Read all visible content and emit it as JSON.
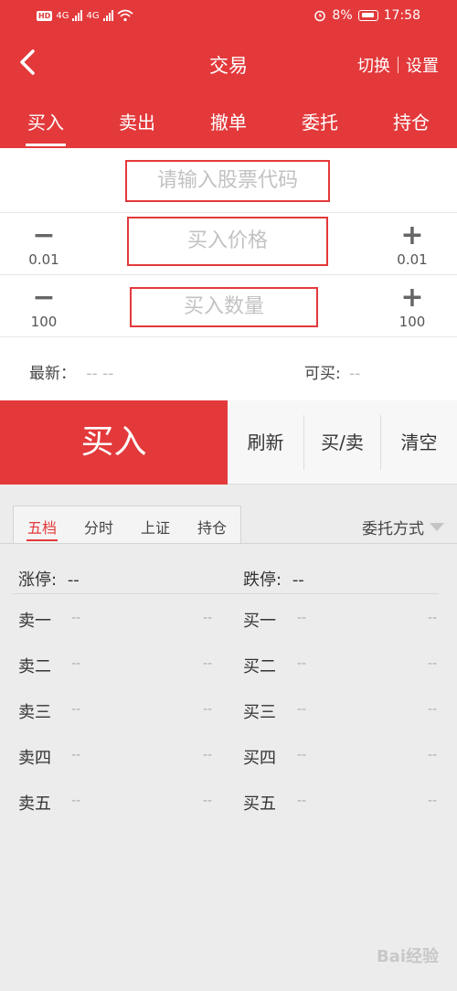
{
  "status_bar": {
    "hd": "HD",
    "net1": "4G",
    "net2": "4G",
    "battery": "8%",
    "time": "17:58"
  },
  "header": {
    "title": "交易",
    "switch_label": "切换",
    "settings_label": "设置"
  },
  "tabs": [
    {
      "label": "买入",
      "active": true
    },
    {
      "label": "卖出"
    },
    {
      "label": "撤单"
    },
    {
      "label": "委托"
    },
    {
      "label": "持仓"
    }
  ],
  "form": {
    "stock_code_placeholder": "请输入股票代码",
    "price_placeholder": "买入价格",
    "quantity_placeholder": "买入数量",
    "price_step_minus": "0.01",
    "price_step_plus": "0.01",
    "qty_step_minus": "100",
    "qty_step_plus": "100",
    "latest_label": "最新：",
    "latest_value": "-- --",
    "buyable_label": "可买:",
    "buyable_value": "--"
  },
  "actions": {
    "buy": "买入",
    "refresh": "刷新",
    "buy_sell": "买/卖",
    "clear": "清空"
  },
  "market": {
    "subtabs": [
      {
        "label": "五档",
        "active": true
      },
      {
        "label": "分时"
      },
      {
        "label": "上证"
      },
      {
        "label": "持仓"
      }
    ],
    "order_type": "委托方式",
    "limit_up_label": "涨停:",
    "limit_up_value": "--",
    "limit_down_label": "跌停:",
    "limit_down_value": "--",
    "sell_levels": [
      {
        "label": "卖一",
        "price": "--",
        "vol": "--"
      },
      {
        "label": "卖二",
        "price": "--",
        "vol": "--"
      },
      {
        "label": "卖三",
        "price": "--",
        "vol": "--"
      },
      {
        "label": "卖四",
        "price": "--",
        "vol": "--"
      },
      {
        "label": "卖五",
        "price": "--",
        "vol": "--"
      }
    ],
    "buy_levels": [
      {
        "label": "买一",
        "price": "--",
        "vol": "--"
      },
      {
        "label": "买二",
        "price": "--",
        "vol": "--"
      },
      {
        "label": "买三",
        "price": "--",
        "vol": "--"
      },
      {
        "label": "买四",
        "price": "--",
        "vol": "--"
      },
      {
        "label": "买五",
        "price": "--",
        "vol": "--"
      }
    ]
  },
  "watermark": "Bai经验"
}
